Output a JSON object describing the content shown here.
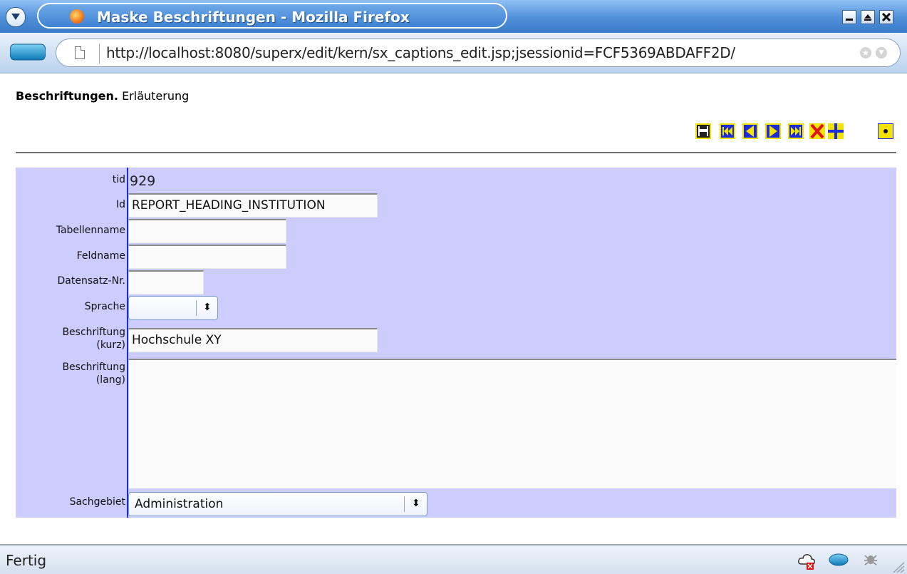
{
  "window": {
    "title": "Maske Beschriftungen - Mozilla Firefox"
  },
  "navbar": {
    "url": "http://localhost:8080/superx/edit/kern/sx_captions_edit.jsp;jsessionid=FCF5369ABDAFF2D/"
  },
  "page": {
    "heading_bold": "Beschriftungen.",
    "heading_rest": " Erläuterung",
    "toolbar_icons": [
      "save-icon",
      "first-record-icon",
      "previous-record-icon",
      "next-record-icon",
      "last-record-icon",
      "delete-icon",
      "new-record-icon",
      "dot-icon"
    ]
  },
  "form": {
    "tid": {
      "label": "tid",
      "value": "929"
    },
    "id": {
      "label": "Id",
      "value": "REPORT_HEADING_INSTITUTION"
    },
    "tabellenname": {
      "label": "Tabellenname",
      "value": ""
    },
    "feldname": {
      "label": "Feldname",
      "value": ""
    },
    "datensatz": {
      "label": "Datensatz-Nr.",
      "value": ""
    },
    "sprache": {
      "label": "Sprache",
      "value": ""
    },
    "beschriftung_kurz": {
      "label_1": "Beschriftung",
      "label_2": "(kurz)",
      "value": "Hochschule XY"
    },
    "beschriftung_lang": {
      "label_1": "Beschriftung",
      "label_2": "(lang)",
      "value": ""
    },
    "sachgebiet": {
      "label": "Sachgebiet",
      "value": "Administration"
    }
  },
  "status": {
    "text": "Fertig"
  },
  "colors": {
    "form_background": "#ccccff",
    "label_border": "#1e2fd0",
    "toolbar_blue": "#1d2bd9",
    "toolbar_yellow": "#f2e300",
    "toolbar_red": "#e01010"
  }
}
